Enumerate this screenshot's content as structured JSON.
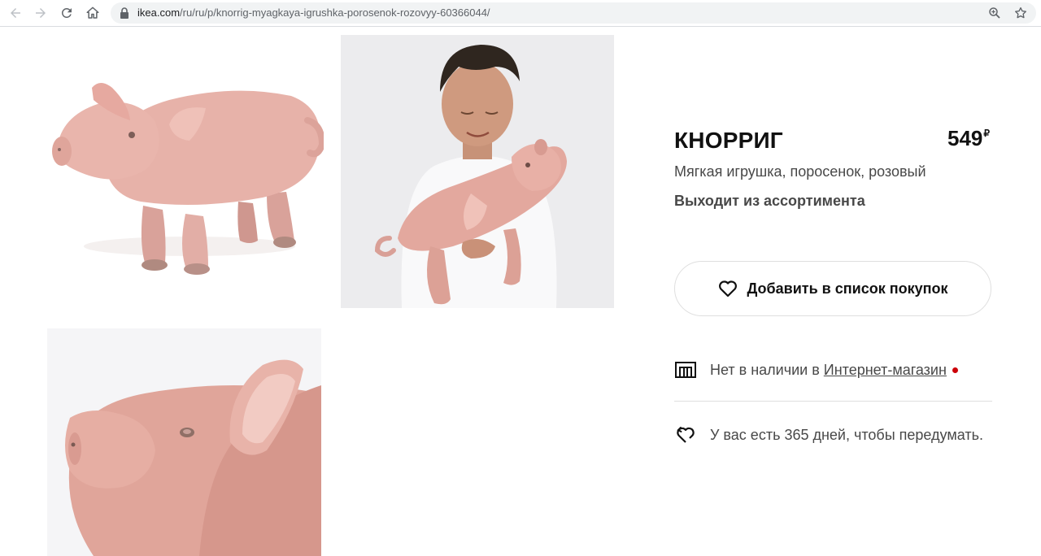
{
  "browser": {
    "url_domain": "ikea.com",
    "url_path": "/ru/ru/p/knorrig-myagkaya-igrushka-porosenok-rozovyy-60366044/"
  },
  "gallery": {
    "images": [
      {
        "subject": "pink plush pig toy side view"
      },
      {
        "subject": "boy holding pink plush pig toy"
      },
      {
        "subject": "close-up of plush pig head"
      }
    ]
  },
  "product": {
    "name": "КНОРРИГ",
    "price": "549",
    "currency": "₽",
    "description": "Мягкая игрушка, поросенок, розовый",
    "status": "Выходит из ассортимента"
  },
  "actions": {
    "add_to_list_label": "Добавить в список покупок"
  },
  "availability": {
    "text": "Нет в наличии в",
    "link": "Интернет-магазин",
    "dot_color": "#cc0008"
  },
  "returns": {
    "text": "У вас есть 365 дней, чтобы передумать."
  }
}
